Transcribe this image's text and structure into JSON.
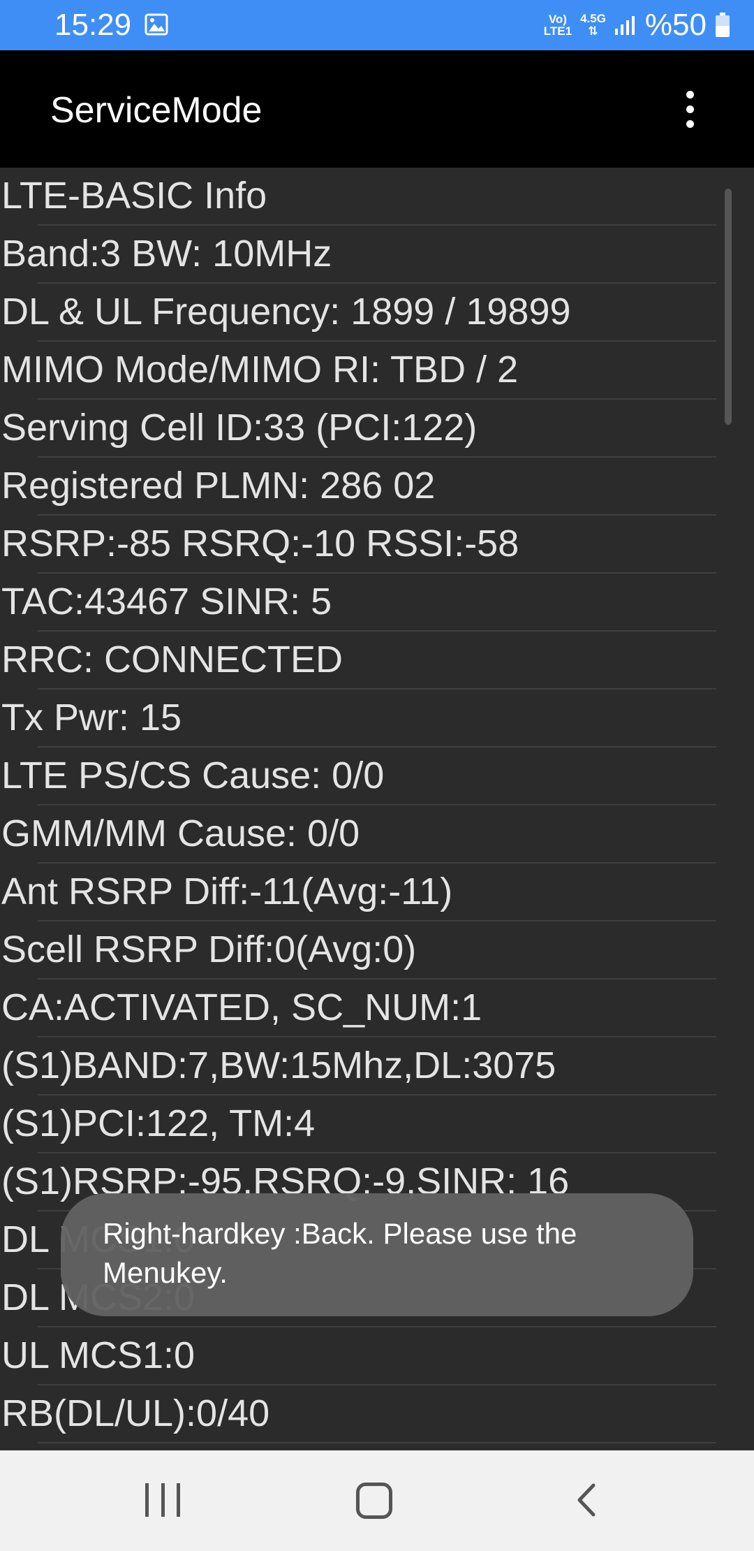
{
  "status_bar": {
    "time": "15:29",
    "volte_top": "Vo)",
    "volte_bottom": "LTE1",
    "network_type": "4.5G",
    "battery": "%50",
    "bg_color": "#3f8ef5"
  },
  "app_bar": {
    "title": "ServiceMode",
    "menu_icon": "overflow-menu-icon"
  },
  "info_lines": [
    "LTE-BASIC Info",
    "Band:3 BW: 10MHz",
    "DL & UL Frequency: 1899 / 19899",
    "MIMO Mode/MIMO RI: TBD / 2",
    "Serving Cell ID:33 (PCI:122)",
    "Registered PLMN: 286 02",
    "RSRP:-85 RSRQ:-10 RSSI:-58",
    "TAC:43467 SINR: 5",
    "RRC: CONNECTED",
    "Tx Pwr: 15",
    "LTE PS/CS Cause: 0/0",
    "GMM/MM Cause: 0/0",
    "Ant RSRP Diff:-11(Avg:-11)",
    "Scell RSRP Diff:0(Avg:0)",
    "CA:ACTIVATED, SC_NUM:1",
    "(S1)BAND:7,BW:15Mhz,DL:3075",
    "(S1)PCI:122, TM:4",
    "(S1)RSRP:-95,RSRQ:-9,SINR: 16",
    "DL MCS1:0",
    "DL MCS2:0",
    "UL MCS1:0",
    "RB(DL/UL):0/40"
  ],
  "toast": {
    "message": "Right-hardkey :Back.   Please use the Menukey."
  },
  "nav_bar": {
    "recents": "recents-icon",
    "home": "home-icon",
    "back": "back-icon"
  }
}
